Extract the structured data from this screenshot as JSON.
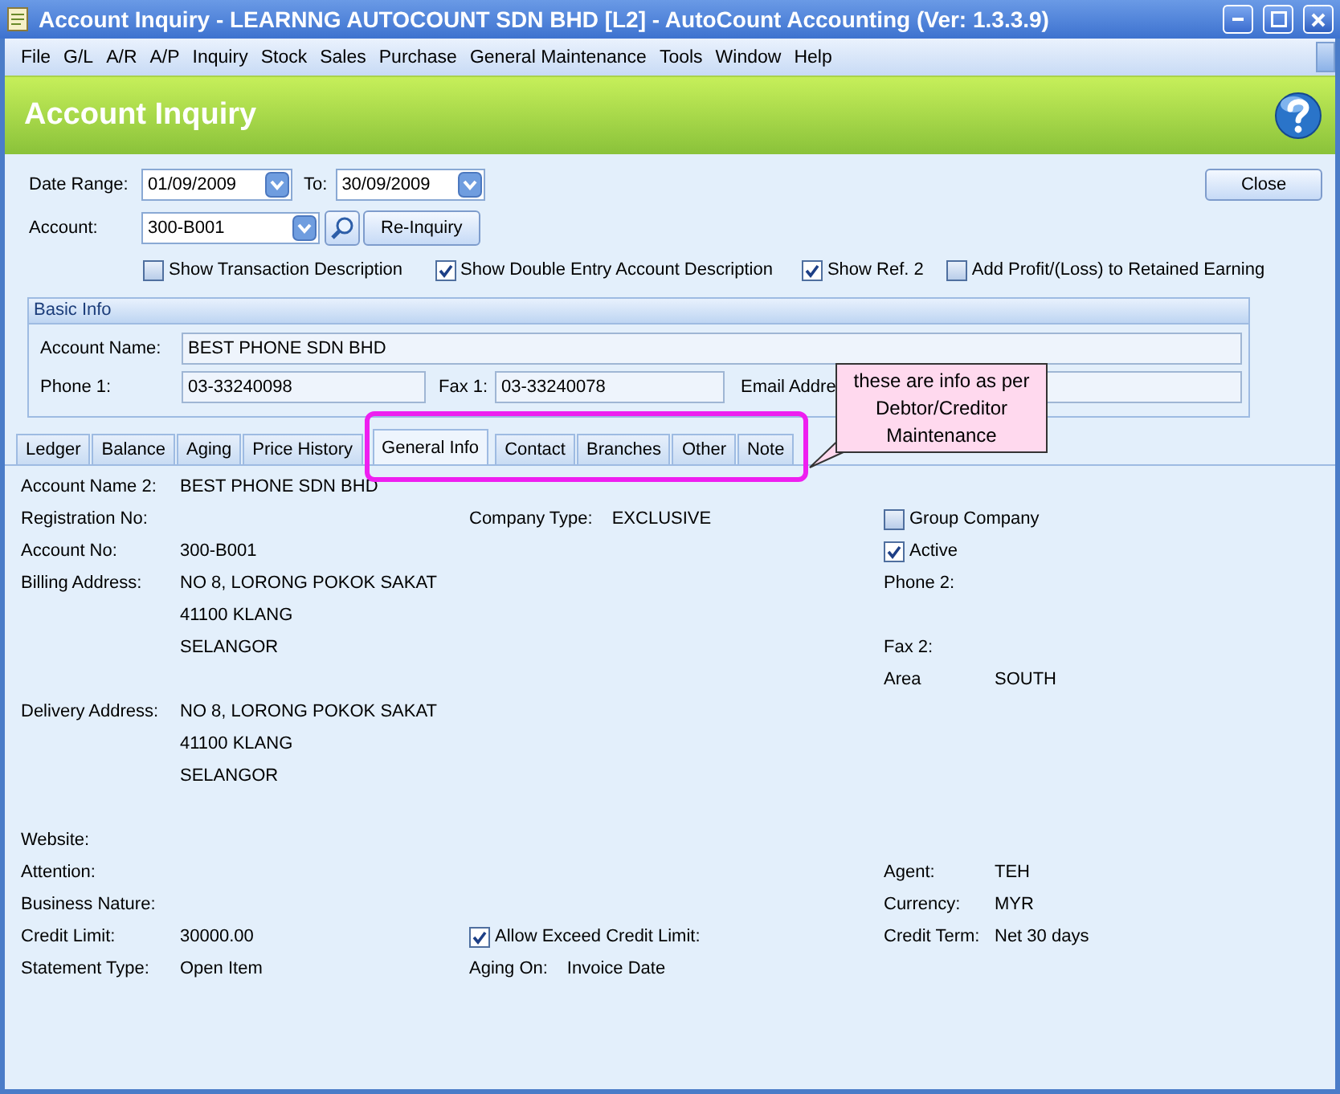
{
  "window": {
    "title": "Account Inquiry - LEARNNG AUTOCOUNT SDN BHD [L2] - AutoCount Accounting (Ver: 1.3.3.9)"
  },
  "menu": [
    "File",
    "G/L",
    "A/R",
    "A/P",
    "Inquiry",
    "Stock",
    "Sales",
    "Purchase",
    "General Maintenance",
    "Tools",
    "Window",
    "Help"
  ],
  "header": {
    "title": "Account Inquiry"
  },
  "filters": {
    "date_from_label": "Date Range:",
    "date_from": "01/09/2009",
    "date_to_label": "To:",
    "date_to": "30/09/2009",
    "account_label": "Account:",
    "account": "300-B001",
    "reinquiry_button": "Re-Inquiry",
    "close_button": "Close",
    "options": [
      {
        "label": "Show Transaction Description",
        "checked": false
      },
      {
        "label": "Show Double Entry Account Description",
        "checked": true
      },
      {
        "label": "Show Ref. 2",
        "checked": true
      },
      {
        "label": "Add Profit/(Loss) to Retained Earning",
        "checked": false
      }
    ]
  },
  "basic_info": {
    "title": "Basic Info",
    "account_name_label": "Account Name:",
    "account_name": "BEST PHONE SDN BHD",
    "phone_label": "Phone 1:",
    "phone": "03-33240098",
    "fax_label": "Fax 1:",
    "fax": "03-33240078",
    "email_label": "Email Addre"
  },
  "tabs": [
    {
      "label": "Ledger",
      "selected": false
    },
    {
      "label": "Balance",
      "selected": false
    },
    {
      "label": "Aging",
      "selected": false
    },
    {
      "label": "Price History",
      "selected": false
    },
    {
      "label": "General Info",
      "selected": true
    },
    {
      "label": "Contact",
      "selected": false
    },
    {
      "label": "Branches",
      "selected": false
    },
    {
      "label": "Other",
      "selected": false
    },
    {
      "label": "Note",
      "selected": false
    }
  ],
  "general_info": {
    "rows": [
      {
        "left": {
          "kind": "field",
          "label": "Account Name 2:",
          "value": "BEST PHONE SDN BHD"
        }
      },
      {
        "left": {
          "kind": "field",
          "label": "Registration No:"
        },
        "middle": {
          "kind": "field",
          "label": "Company Type:",
          "value": "EXCLUSIVE"
        },
        "right": {
          "kind": "check",
          "label": "Group Company",
          "checked": false
        }
      },
      {
        "left": {
          "kind": "field",
          "label": "Account No:",
          "value": "300-B001"
        },
        "right": {
          "kind": "check",
          "label": "Active",
          "checked": true
        }
      },
      {
        "left": {
          "kind": "field",
          "label": "Billing Address:",
          "value": "NO 8, LORONG POKOK SAKAT"
        },
        "right": {
          "kind": "field",
          "label": "Phone 2:"
        }
      },
      {
        "left": {
          "kind": "field",
          "value": "41100 KLANG"
        }
      },
      {
        "left": {
          "kind": "field",
          "value": "SELANGOR"
        },
        "right": {
          "kind": "field",
          "label": "Fax 2:"
        }
      },
      {
        "right": {
          "kind": "field",
          "label": "Area",
          "value": "SOUTH"
        }
      },
      {
        "left": {
          "kind": "field",
          "label": "Delivery Address:",
          "value": "NO 8, LORONG POKOK SAKAT"
        }
      },
      {
        "left": {
          "kind": "field",
          "value": "41100 KLANG"
        }
      },
      {
        "left": {
          "kind": "field",
          "value": "SELANGOR"
        }
      },
      {},
      {
        "left": {
          "kind": "field",
          "label": "Website:"
        }
      },
      {
        "left": {
          "kind": "field",
          "label": "Attention:"
        },
        "right": {
          "kind": "field",
          "label": "Agent:",
          "value": "TEH"
        }
      },
      {
        "left": {
          "kind": "field",
          "label": "Business Nature:"
        },
        "right": {
          "kind": "field",
          "label": "Currency:",
          "value": "MYR"
        }
      },
      {
        "left": {
          "kind": "field",
          "label": "Credit Limit:",
          "value": "30000.00"
        },
        "middle": {
          "kind": "check",
          "label": "Allow Exceed Credit Limit:",
          "checked": true
        },
        "right": {
          "kind": "field",
          "label": "Credit Term:",
          "value": "Net 30 days"
        }
      },
      {
        "left": {
          "kind": "field",
          "label": "Statement Type:",
          "value": "Open Item"
        },
        "middle": {
          "kind": "field",
          "label": "Aging On:",
          "value": "Invoice Date"
        }
      }
    ]
  },
  "annotation": {
    "text": "these are info as per Debtor/Creditor Maintenance"
  }
}
